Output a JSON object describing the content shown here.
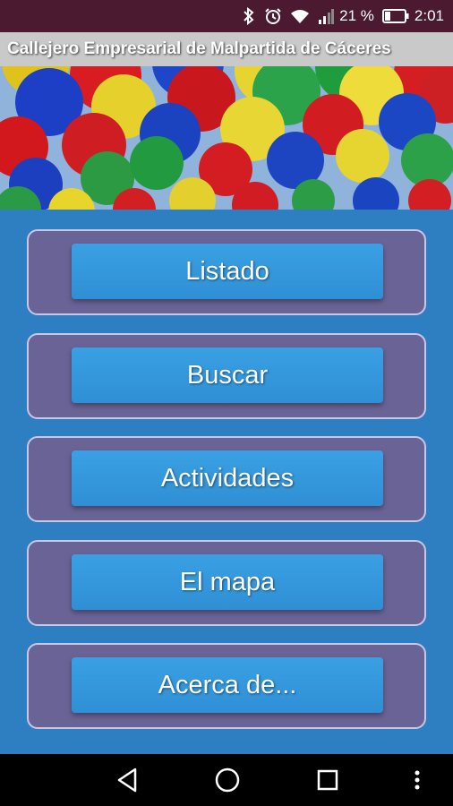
{
  "status_bar": {
    "battery_percent": "21 %",
    "time": "2:01",
    "icons": [
      "bluetooth-icon",
      "alarm-icon",
      "wifi-icon",
      "signal-icon",
      "battery-icon"
    ]
  },
  "app": {
    "title": "Callejero Empresarial de Malpartida de Cáceres"
  },
  "banner": {
    "icon": "umbrellas-photo"
  },
  "menu": {
    "items": [
      {
        "label": "Listado"
      },
      {
        "label": "Buscar"
      },
      {
        "label": "Actividades"
      },
      {
        "label": "El mapa"
      },
      {
        "label": "Acerca de..."
      }
    ]
  },
  "nav_bar": {
    "icons": [
      "back-icon",
      "home-icon",
      "recents-icon",
      "more-icon"
    ]
  },
  "colors": {
    "status_bar": "#4c1a30",
    "title_bar": "#c9c9c9",
    "background": "#2e7fc1",
    "card": "#6a6396",
    "button": "#3197dc"
  }
}
